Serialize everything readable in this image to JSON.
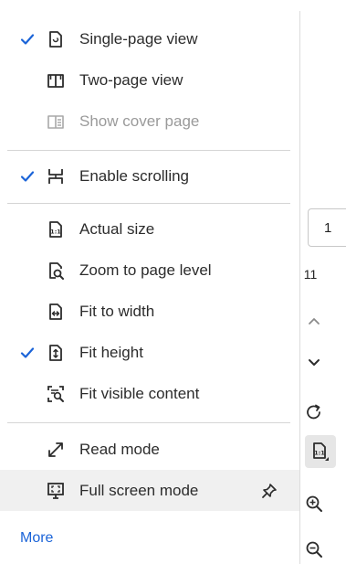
{
  "menu": {
    "items": [
      {
        "label": "Single-page view",
        "checked": true,
        "icon": "single-page-icon"
      },
      {
        "label": "Two-page view",
        "checked": false,
        "icon": "two-page-icon"
      },
      {
        "label": "Show cover page",
        "checked": false,
        "disabled": true,
        "icon": "cover-page-icon"
      },
      {
        "label": "Enable scrolling",
        "checked": true,
        "icon": "scrolling-icon"
      },
      {
        "label": "Actual size",
        "checked": false,
        "icon": "actual-size-icon"
      },
      {
        "label": "Zoom to page level",
        "checked": false,
        "icon": "zoom-page-level-icon"
      },
      {
        "label": "Fit to width",
        "checked": false,
        "icon": "fit-width-icon"
      },
      {
        "label": "Fit height",
        "checked": true,
        "icon": "fit-height-icon"
      },
      {
        "label": "Fit visible content",
        "checked": false,
        "icon": "fit-visible-icon"
      },
      {
        "label": "Read mode",
        "checked": false,
        "icon": "read-mode-icon"
      },
      {
        "label": "Full screen mode",
        "checked": false,
        "icon": "full-screen-icon",
        "hover": true,
        "pin_icon": "pin-icon"
      }
    ],
    "more_label": "More"
  },
  "toolbar": {
    "current_page": "1",
    "total_pages": "11",
    "icons": [
      "chevron-up-icon",
      "chevron-down-icon",
      "rotate-icon",
      "actual-size-icon",
      "zoom-in-icon",
      "zoom-out-icon"
    ]
  },
  "colors": {
    "accent": "#1b64d8",
    "text": "#2c2c2c",
    "disabled": "#9a9a9a",
    "hover_bg": "#f0f0f0",
    "divider": "#d5d5d5"
  }
}
